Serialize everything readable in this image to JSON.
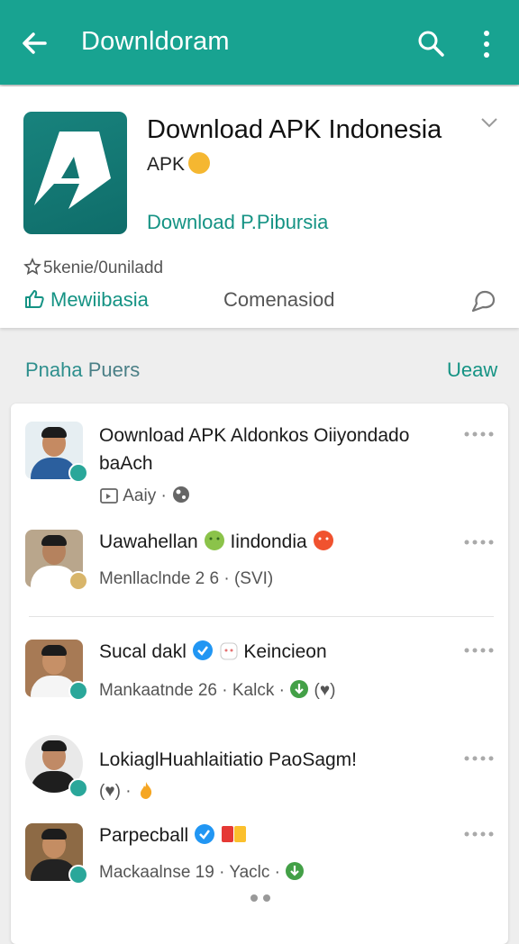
{
  "appbar": {
    "title": "Downldoram"
  },
  "app": {
    "name": "Download APK Indonesia",
    "subtitle": "APK",
    "link": "Download P.Pibursia",
    "rating_text": "5kenie/0uniladd",
    "action_left": "Mewiibasia",
    "action_mid": "Comenasiod"
  },
  "section": {
    "title_a": "Pnaha",
    "title_b": " Puers",
    "link": "Ueaw"
  },
  "items": [
    {
      "title": "Oownload APK Aldonkos Oiiyondado baAch",
      "meta": "Aaiy",
      "dot": " · "
    },
    {
      "title": "Uawahellan",
      "title2": " Iindondia",
      "meta": "Menllaclnde  2 6 · (SVI)"
    },
    {
      "title": "Sucal dakl",
      "title2": " Keincieon",
      "meta": "Mankaatnde  26 · Kalck",
      "meta2": " · ",
      "meta3": " (♥)"
    },
    {
      "title": "LokiaglHuahlaitiatio PaoSagm!",
      "meta": "(♥) ·"
    },
    {
      "title": "Parpecball",
      "meta": "Mackaalnse  19 · Yaclc ·"
    }
  ],
  "colors": {
    "appbar": "#18a391",
    "accent": "#159384",
    "verified": "#2aa79a"
  }
}
